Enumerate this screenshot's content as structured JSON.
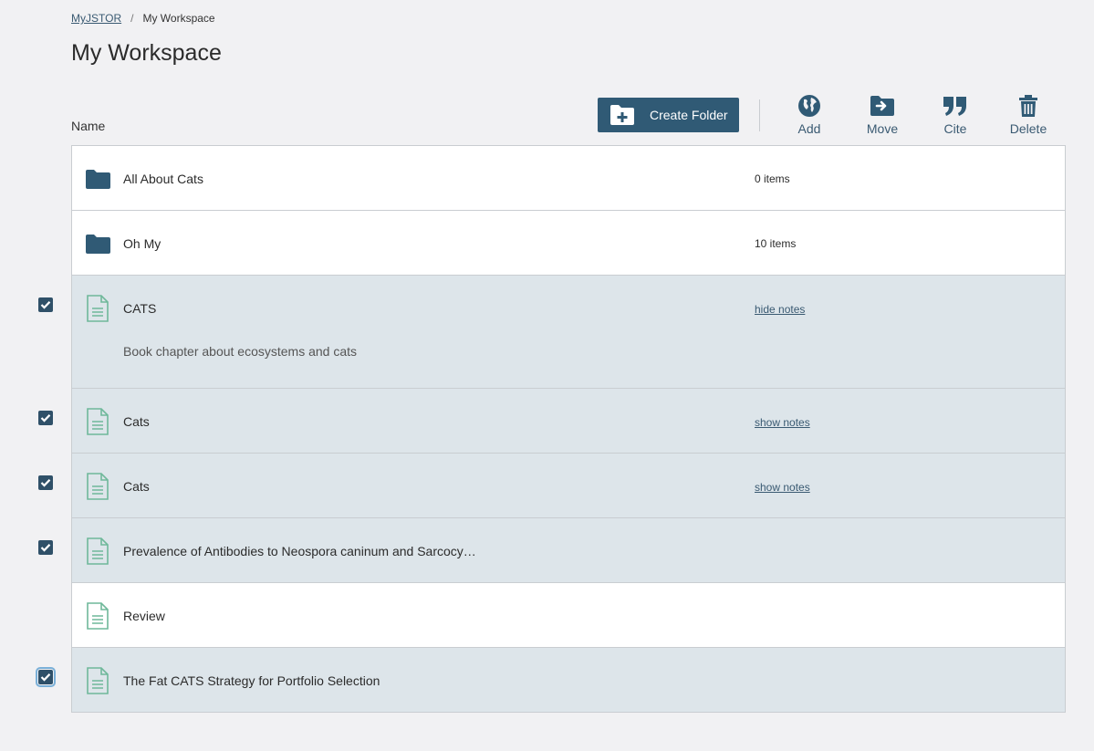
{
  "breadcrumb": {
    "root": "MyJSTOR",
    "separator": "/",
    "current": "My Workspace"
  },
  "page": {
    "title": "My Workspace"
  },
  "list_header": {
    "name": "Name"
  },
  "toolbar": {
    "create_folder": "Create Folder",
    "add": "Add",
    "move": "Move",
    "cite": "Cite",
    "delete": "Delete"
  },
  "items": [
    {
      "type": "folder",
      "title": "All About Cats",
      "meta": "0 items",
      "selected": false
    },
    {
      "type": "folder",
      "title": "Oh My",
      "meta": "10 items",
      "selected": false
    },
    {
      "type": "document",
      "title": "CATS",
      "link": "hide notes",
      "notes": "Book chapter about ecosystems and cats",
      "selected": true
    },
    {
      "type": "document",
      "title": "Cats",
      "link": "show notes",
      "selected": true
    },
    {
      "type": "document",
      "title": "Cats",
      "link": "show notes",
      "selected": true
    },
    {
      "type": "document",
      "title": "Prevalence of Antibodies to Neospora caninum and Sarcocy…",
      "selected": true
    },
    {
      "type": "document",
      "title": "Review",
      "selected": false
    },
    {
      "type": "document",
      "title": "The Fat CATS Strategy for Portfolio Selection",
      "selected": true,
      "focused": true
    }
  ],
  "colors": {
    "accent": "#305a75",
    "selected_row": "#dde5ea",
    "doc_icon": "#6fb89a"
  }
}
